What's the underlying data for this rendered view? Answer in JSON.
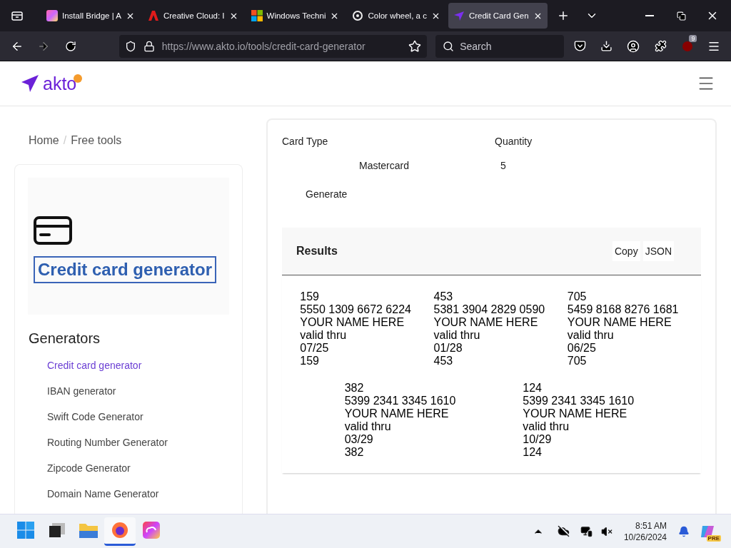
{
  "browser": {
    "tabs": [
      {
        "title": "Install Bridge | A",
        "kind": "gradient",
        "selected": false
      },
      {
        "title": "Creative Cloud: I",
        "kind": "adobe",
        "selected": false
      },
      {
        "title": "Windows Techni",
        "kind": "windows",
        "selected": false
      },
      {
        "title": "Color wheel, a c",
        "kind": "wheel",
        "selected": false
      },
      {
        "title": "Credit Card Gen",
        "kind": "akto",
        "selected": true
      }
    ],
    "url": "https://www.akto.io/tools/credit-card-generator",
    "search": {
      "placeholder": "Search"
    },
    "extension_badge": "9"
  },
  "site": {
    "logo": "akto",
    "breadcrumb": [
      "Home",
      "Free tools"
    ],
    "breadcrumb_separator": "/",
    "tool_title": "Credit card generator",
    "generators_heading": "Generators",
    "generators": [
      {
        "label": "Credit card generator",
        "selected": true
      },
      {
        "label": "IBAN generator",
        "selected": false
      },
      {
        "label": "Swift Code Generator",
        "selected": false
      },
      {
        "label": "Routing Number Generator",
        "selected": false
      },
      {
        "label": "Zipcode Generator",
        "selected": false
      },
      {
        "label": "Domain Name Generator",
        "selected": false
      }
    ],
    "form": {
      "card_type_label": "Card Type",
      "card_type": "Mastercard",
      "quantity_label": "Quantity",
      "quantity": "5",
      "generate": "Generate"
    },
    "results": {
      "title": "Results",
      "actions": [
        "Copy",
        "JSON"
      ],
      "cards": [
        {
          "lines": [
            "159",
            "5550 1309 6672 6224",
            "YOUR NAME HERE",
            "valid thru",
            "07/25",
            "159"
          ]
        },
        {
          "lines": [
            "453",
            "5381 3904 2829 0590",
            "YOUR NAME HERE",
            "valid thru",
            "01/28",
            "453"
          ]
        },
        {
          "lines": [
            "705",
            "5459 8168 8276 1681",
            "YOUR NAME HERE",
            "valid thru",
            "06/25",
            "705"
          ]
        },
        {
          "lines": [
            "382",
            "5399 2341 3345 1610",
            "YOUR NAME HERE",
            "valid thru",
            "03/29",
            "382"
          ]
        },
        {
          "lines": [
            "124",
            "5399 2341 3345 1610",
            "YOUR NAME HERE",
            "valid thru",
            "10/29",
            "124"
          ]
        }
      ]
    }
  },
  "taskbar": {
    "apps": [
      {
        "kind": "start",
        "active": false
      },
      {
        "kind": "terminal",
        "active": false
      },
      {
        "kind": "folder",
        "active": false
      },
      {
        "kind": "firefox",
        "active": true
      },
      {
        "kind": "cloud",
        "active": false
      }
    ],
    "time": "8:51 AM",
    "date": "10/26/2024",
    "copilot_badge": "PRE"
  }
}
